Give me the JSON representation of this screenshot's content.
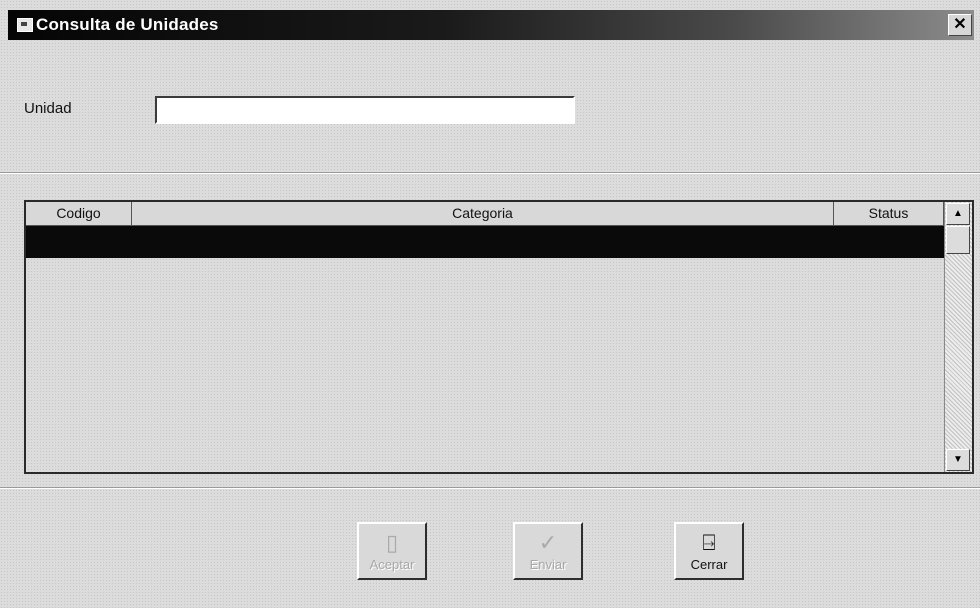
{
  "window": {
    "title": "Consulta de Unidades",
    "close_glyph": "✕"
  },
  "form": {
    "unidad_label": "Unidad",
    "unidad_value": ""
  },
  "grid": {
    "columns": [
      "Codigo",
      "Categoria",
      "Status"
    ],
    "rows": [],
    "scroll_up_glyph": "▲",
    "scroll_down_glyph": "▼"
  },
  "buttons": {
    "seleccionar": {
      "label": "Aceptar",
      "icon": "document-icon",
      "glyph": "▯",
      "enabled": false
    },
    "enviar": {
      "label": "Enviar",
      "icon": "checkmark-icon",
      "glyph": "✓",
      "enabled": false
    },
    "cerrar": {
      "label": "Cerrar",
      "icon": "door-exit-icon",
      "glyph": "⍈",
      "enabled": true
    }
  },
  "colors": {
    "titlebar_start": "#050505",
    "titlebar_end": "#8c8c8c",
    "selected_row": "#0a0a0a"
  }
}
